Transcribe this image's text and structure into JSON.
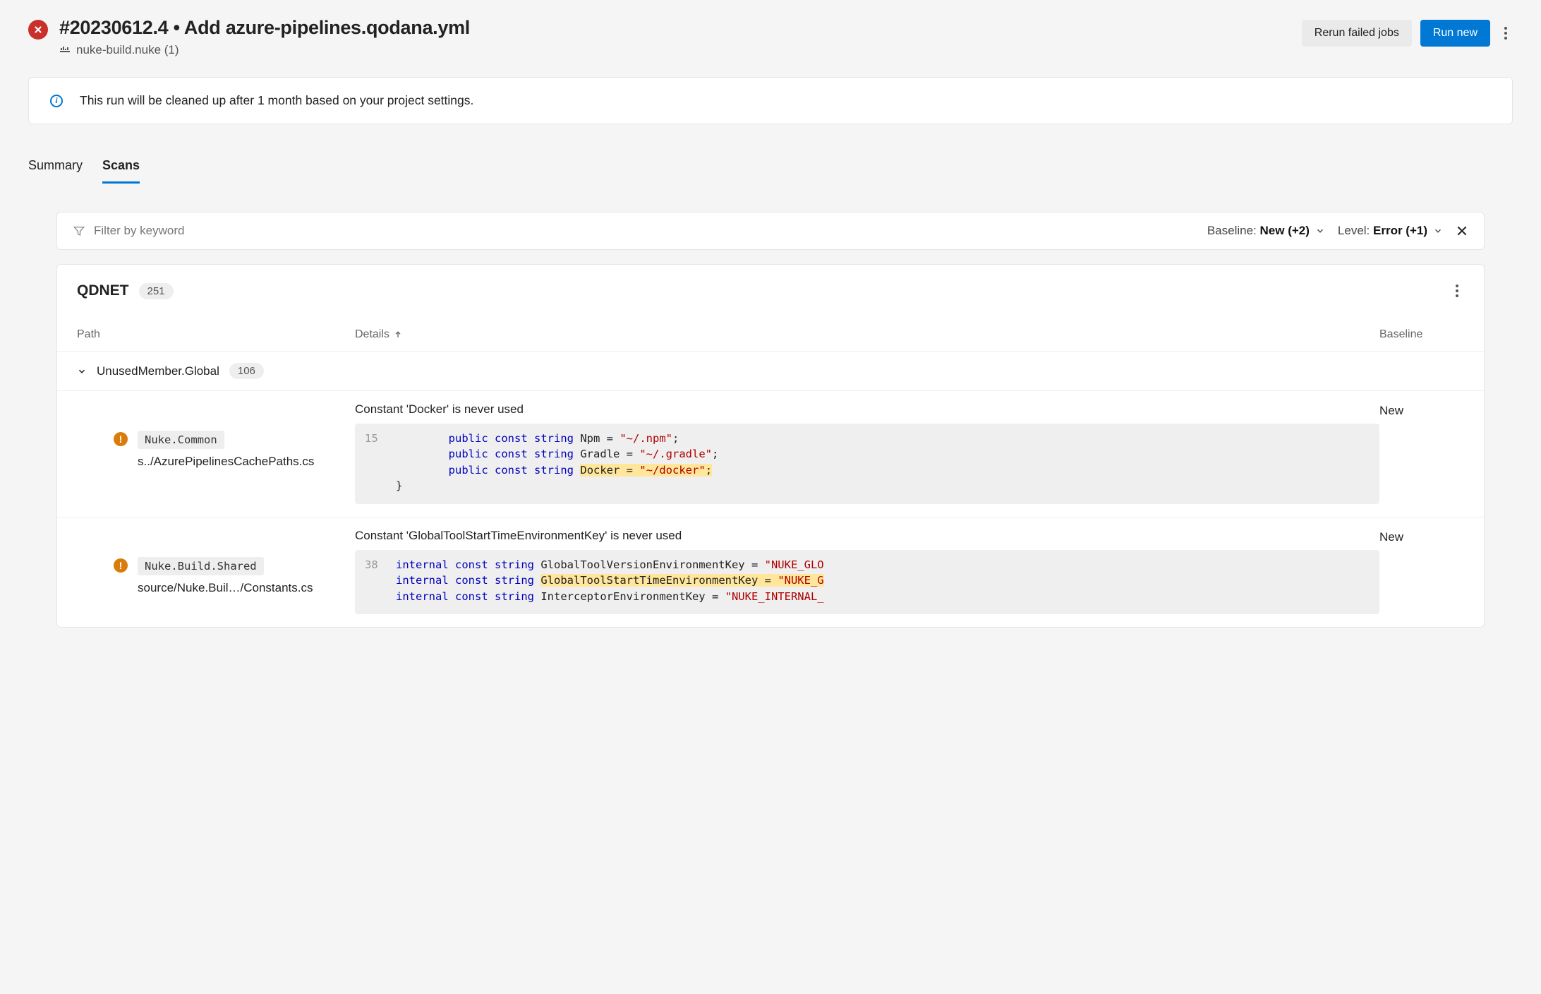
{
  "header": {
    "title": "#20230612.4 • Add azure-pipelines.qodana.yml",
    "repo": "nuke-build.nuke (1)",
    "rerun_label": "Rerun failed jobs",
    "runnew_label": "Run new"
  },
  "banner": {
    "text": "This run will be cleaned up after 1 month based on your project settings."
  },
  "tabs": {
    "summary": "Summary",
    "scans": "Scans"
  },
  "filter": {
    "placeholder": "Filter by keyword",
    "baseline_label": "Baseline: ",
    "baseline_value": "New (+2)",
    "level_label": "Level: ",
    "level_value": "Error (+1)"
  },
  "scan": {
    "name": "QDNET",
    "count": "251",
    "columns": {
      "path": "Path",
      "details": "Details",
      "baseline": "Baseline"
    },
    "group": {
      "name": "UnusedMember.Global",
      "count": "106"
    },
    "issues": [
      {
        "module": "Nuke.Common",
        "file": "s../AzurePipelinesCachePaths.cs",
        "title": "Constant 'Docker' is never used",
        "line_num": "15",
        "baseline": "New",
        "code": [
          {
            "indent": 2,
            "tokens": [
              {
                "t": "public",
                "c": "kw"
              },
              {
                "t": " "
              },
              {
                "t": "const",
                "c": "kw"
              },
              {
                "t": " "
              },
              {
                "t": "string",
                "c": "type"
              },
              {
                "t": " Npm = "
              },
              {
                "t": "\"~/.npm\"",
                "c": "str"
              },
              {
                "t": ";"
              }
            ]
          },
          {
            "indent": 2,
            "tokens": [
              {
                "t": "public",
                "c": "kw"
              },
              {
                "t": " "
              },
              {
                "t": "const",
                "c": "kw"
              },
              {
                "t": " "
              },
              {
                "t": "string",
                "c": "type"
              },
              {
                "t": " Gradle = "
              },
              {
                "t": "\"~/.gradle\"",
                "c": "str"
              },
              {
                "t": ";"
              }
            ]
          },
          {
            "indent": 2,
            "tokens": [
              {
                "t": "public",
                "c": "kw"
              },
              {
                "t": " "
              },
              {
                "t": "const",
                "c": "kw"
              },
              {
                "t": " "
              },
              {
                "t": "string",
                "c": "type"
              },
              {
                "t": " "
              },
              {
                "t": "Docker = ",
                "hl": true
              },
              {
                "t": "\"~/docker\"",
                "c": "str",
                "hl": true
              },
              {
                "t": ";",
                "hl": true
              }
            ]
          },
          {
            "indent": 0,
            "tokens": [
              {
                "t": "}"
              }
            ]
          }
        ]
      },
      {
        "module": "Nuke.Build.Shared",
        "file": "source/Nuke.Buil…/Constants.cs",
        "title": "Constant 'GlobalToolStartTimeEnvironmentKey' is never used",
        "line_num": "38",
        "baseline": "New",
        "code": [
          {
            "indent": 0,
            "tokens": [
              {
                "t": "internal",
                "c": "kw"
              },
              {
                "t": " "
              },
              {
                "t": "const",
                "c": "kw"
              },
              {
                "t": " "
              },
              {
                "t": "string",
                "c": "type"
              },
              {
                "t": " GlobalToolVersionEnvironmentKey = "
              },
              {
                "t": "\"NUKE_GLO",
                "c": "str"
              }
            ]
          },
          {
            "indent": 0,
            "tokens": [
              {
                "t": "internal",
                "c": "kw"
              },
              {
                "t": " "
              },
              {
                "t": "const",
                "c": "kw"
              },
              {
                "t": " "
              },
              {
                "t": "string",
                "c": "type"
              },
              {
                "t": " "
              },
              {
                "t": "GlobalToolStartTimeEnvironmentKey = ",
                "hl": true
              },
              {
                "t": "\"NUKE_G",
                "c": "str",
                "hl": true
              }
            ]
          },
          {
            "indent": 0,
            "tokens": [
              {
                "t": "internal",
                "c": "kw"
              },
              {
                "t": " "
              },
              {
                "t": "const",
                "c": "kw"
              },
              {
                "t": " "
              },
              {
                "t": "string",
                "c": "type"
              },
              {
                "t": " InterceptorEnvironmentKey = "
              },
              {
                "t": "\"NUKE_INTERNAL_",
                "c": "str"
              }
            ]
          }
        ]
      }
    ]
  }
}
